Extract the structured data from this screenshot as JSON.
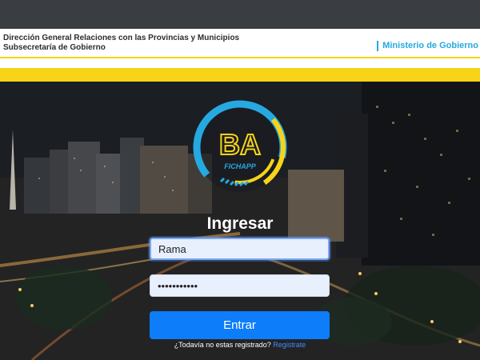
{
  "header": {
    "org_line1": "Dirección General Relaciones con las Provincias y Municipios",
    "org_line2": "Subsecretaría de Gobierno",
    "ministry": "Ministerio de Gobierno"
  },
  "logo": {
    "letters": "BA",
    "app_name": "FICHAPP"
  },
  "login": {
    "title": "Ingresar",
    "username_value": "Rama",
    "password_value": "•••••••••••",
    "submit_label": "Entrar",
    "register_prompt": "¿Todavía no estas registrado?",
    "register_link": "Registrate"
  },
  "colors": {
    "accent_yellow": "#f7d417",
    "brand_blue": "#26a9e0",
    "button_blue": "#0d7df9"
  }
}
